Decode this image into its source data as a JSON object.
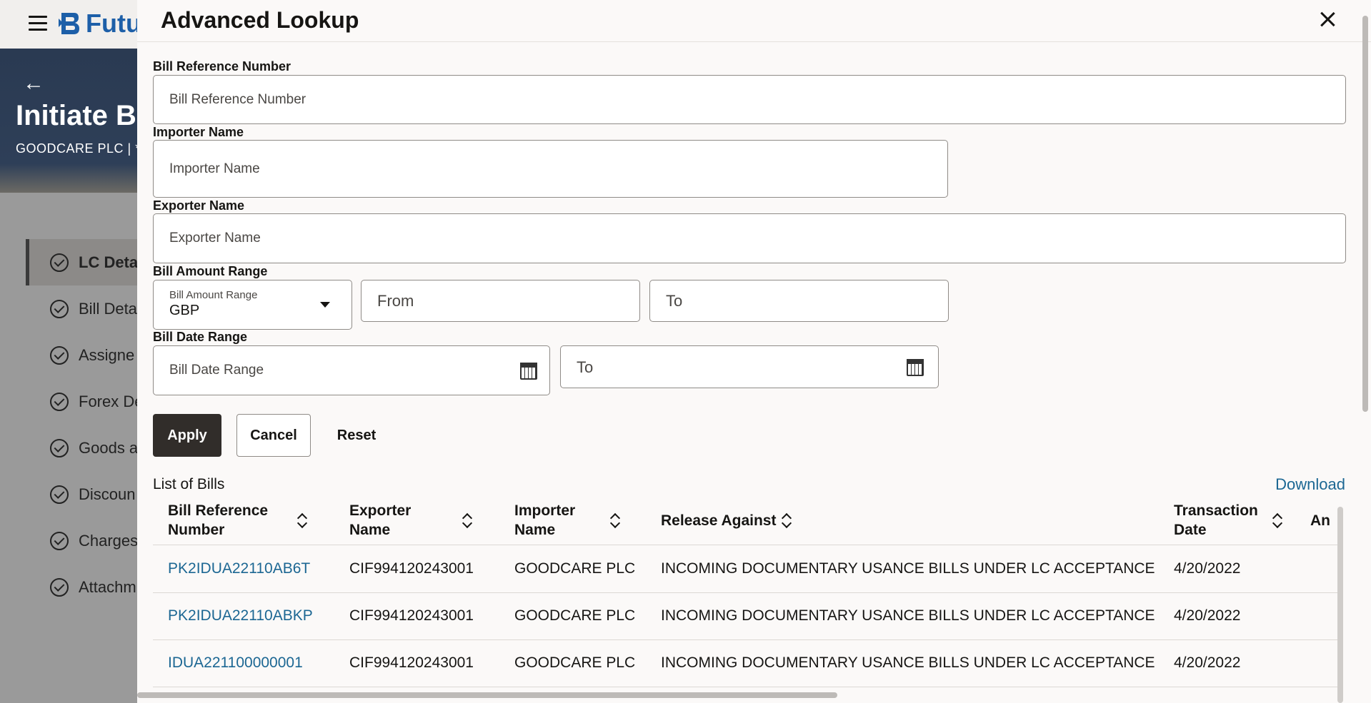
{
  "background": {
    "app_name": "Futu",
    "page_title": "Initiate Bi",
    "page_subtitle": "GOODCARE PLC | **",
    "back_glyph": "←",
    "nav_items": [
      {
        "label": "LC Detai",
        "active": true
      },
      {
        "label": "Bill Deta",
        "active": false
      },
      {
        "label": "Assigne",
        "active": false
      },
      {
        "label": "Forex De",
        "active": false
      },
      {
        "label": "Goods a",
        "active": false
      },
      {
        "label": "Discoun",
        "active": false
      },
      {
        "label": "Charges",
        "active": false
      },
      {
        "label": "Attachm",
        "active": false
      }
    ]
  },
  "modal": {
    "title": "Advanced Lookup",
    "fields": {
      "bill_ref": {
        "label": "Bill Reference Number",
        "placeholder": "Bill Reference Number",
        "value": ""
      },
      "importer": {
        "label": "Importer Name",
        "placeholder": "Importer Name",
        "value": ""
      },
      "exporter": {
        "label": "Exporter Name",
        "placeholder": "Exporter Name",
        "value": ""
      },
      "amount_range": {
        "label": "Bill Amount Range",
        "currency_label": "Bill Amount Range",
        "currency_value": "GBP",
        "from_placeholder": "From",
        "to_placeholder": "To"
      },
      "date_range": {
        "label": "Bill Date Range",
        "from_placeholder": "Bill Date Range",
        "to_placeholder": "To"
      }
    },
    "buttons": {
      "apply": "Apply",
      "cancel": "Cancel",
      "reset": "Reset"
    },
    "list": {
      "title": "List of Bills",
      "download": "Download",
      "columns": [
        {
          "line1": "Bill Reference",
          "line2": "Number"
        },
        {
          "line1": "Exporter",
          "line2": "Name"
        },
        {
          "line1": "Importer",
          "line2": "Name"
        },
        {
          "line1": "Release Against",
          "line2": ""
        },
        {
          "line1": "Transaction",
          "line2": "Date"
        },
        {
          "line1": "An",
          "line2": ""
        }
      ],
      "rows": [
        {
          "ref": "PK2IDUA22110AB6T",
          "exporter": "CIF994120243001",
          "importer": "GOODCARE PLC",
          "release": "INCOMING DOCUMENTARY USANCE BILLS UNDER LC ACCEPTANCE",
          "date": "4/20/2022"
        },
        {
          "ref": "PK2IDUA22110ABKP",
          "exporter": "CIF994120243001",
          "importer": "GOODCARE PLC",
          "release": "INCOMING DOCUMENTARY USANCE BILLS UNDER LC ACCEPTANCE",
          "date": "4/20/2022"
        },
        {
          "ref": "IDUA221100000001",
          "exporter": "CIF994120243001",
          "importer": "GOODCARE PLC",
          "release": "INCOMING DOCUMENTARY USANCE BILLS UNDER LC ACCEPTANCE",
          "date": "4/20/2022"
        }
      ]
    }
  },
  "colors": {
    "brand": "#1d5fa8",
    "link": "#1c6793",
    "primary_button": "#312d2a",
    "overlay": "#9d9d9d"
  }
}
